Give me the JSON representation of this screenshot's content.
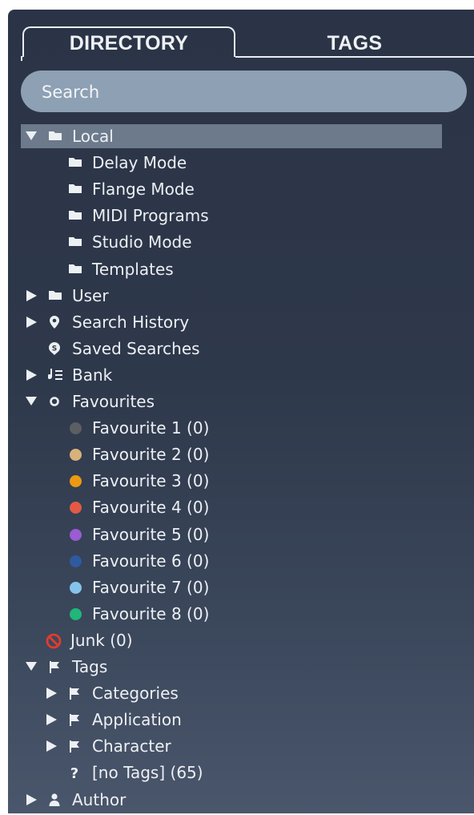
{
  "tabs": {
    "directory": "DIRECTORY",
    "tags": "TAGS"
  },
  "search": {
    "placeholder": "Search"
  },
  "tree": [
    {
      "label": "Local",
      "icon": "folder-icon",
      "expander": "expanded",
      "selected": true
    },
    {
      "label": "Delay Mode",
      "icon": "folder-icon"
    },
    {
      "label": "Flange Mode",
      "icon": "folder-icon"
    },
    {
      "label": "MIDI Programs",
      "icon": "folder-icon"
    },
    {
      "label": "Studio Mode",
      "icon": "folder-icon"
    },
    {
      "label": "Templates",
      "icon": "folder-icon"
    },
    {
      "label": "User",
      "icon": "folder-icon",
      "expander": "collapsed"
    },
    {
      "label": "Search History",
      "icon": "location-pin-icon",
      "expander": "collapsed"
    },
    {
      "label": "Saved Searches",
      "icon": "saved-search-icon"
    },
    {
      "label": "Bank",
      "icon": "bank-icon",
      "expander": "collapsed"
    },
    {
      "label": "Favourites",
      "icon": "favourites-ring-icon",
      "expander": "expanded"
    },
    {
      "label": "Favourite 1 (0)",
      "icon": "color-dot-icon",
      "color": "#5b5e63"
    },
    {
      "label": "Favourite 2 (0)",
      "icon": "color-dot-icon",
      "color": "#d9b27a"
    },
    {
      "label": "Favourite 3 (0)",
      "icon": "color-dot-icon",
      "color": "#eb9a12"
    },
    {
      "label": "Favourite 4 (0)",
      "icon": "color-dot-icon",
      "color": "#e15a46"
    },
    {
      "label": "Favourite 5 (0)",
      "icon": "color-dot-icon",
      "color": "#9b5bd1"
    },
    {
      "label": "Favourite 6 (0)",
      "icon": "color-dot-icon",
      "color": "#2f5aa0"
    },
    {
      "label": "Favourite 7 (0)",
      "icon": "color-dot-icon",
      "color": "#86c3ea"
    },
    {
      "label": "Favourite 8 (0)",
      "icon": "color-dot-icon",
      "color": "#1fb77a"
    },
    {
      "label": "Junk (0)",
      "icon": "junk-prohibited-icon"
    },
    {
      "label": "Tags",
      "icon": "flag-icon",
      "expander": "expanded"
    },
    {
      "label": "Categories",
      "icon": "flag-icon",
      "expander": "collapsed"
    },
    {
      "label": "Application",
      "icon": "flag-icon",
      "expander": "collapsed"
    },
    {
      "label": "Character",
      "icon": "flag-icon",
      "expander": "collapsed"
    },
    {
      "label": "[no Tags] (65)",
      "icon": "question-mark-icon"
    },
    {
      "label": "Author",
      "icon": "person-icon",
      "expander": "collapsed"
    }
  ]
}
